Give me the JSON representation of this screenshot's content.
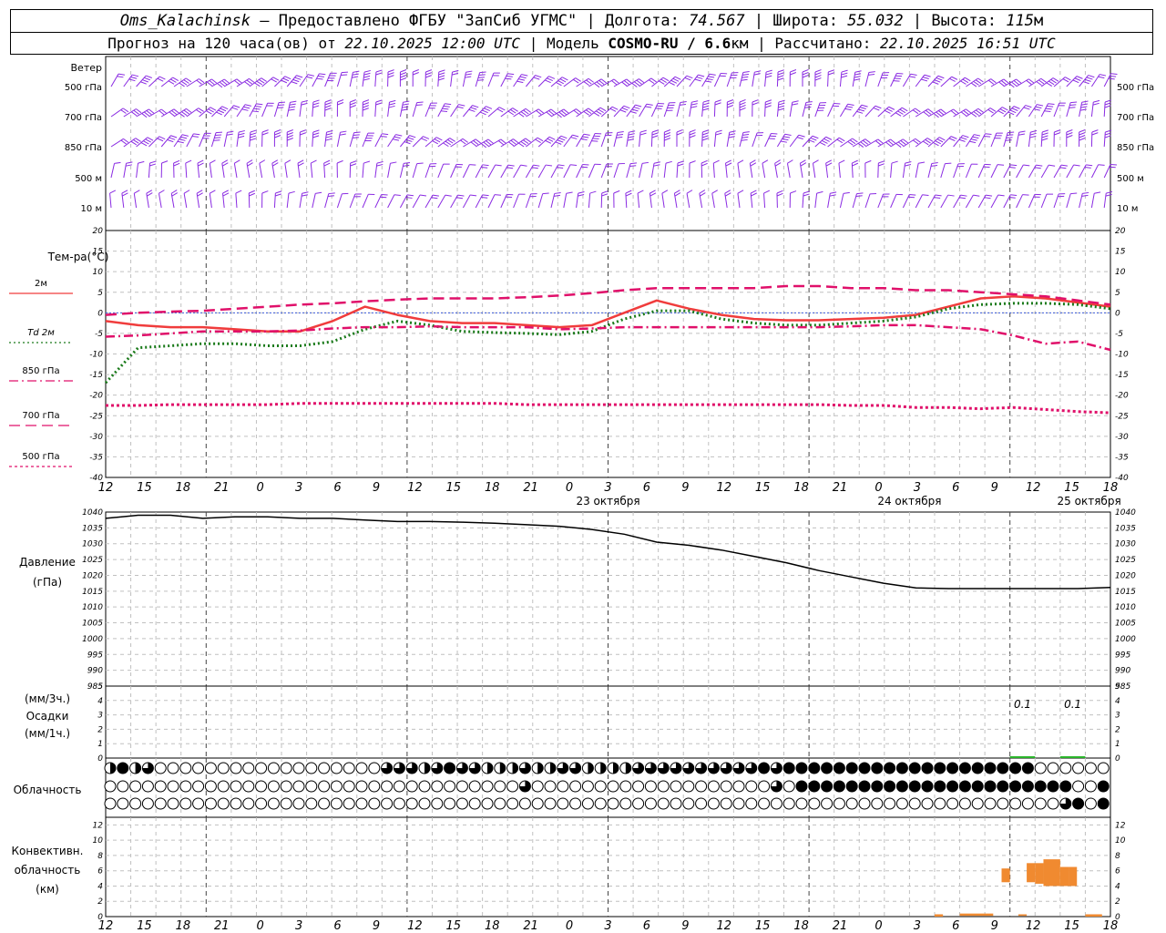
{
  "header": {
    "station": "Oms_Kalachinsk",
    "provider": "Предоставлено ФГБУ \"ЗапСиб УГМС\"",
    "lon_label": "Долгота:",
    "lon_value": "74.567",
    "lat_label": "Широта:",
    "lat_value": "55.032",
    "alt_label": "Высота:",
    "alt_value": "115",
    "alt_unit": "м",
    "forecast_label": "Прогноз на 120 часа(ов) от",
    "forecast_time": "22.10.2025 12:00 UTC",
    "model_label": "Модель",
    "model_name": "COSMO-RU / 6.6",
    "model_unit": "км",
    "calc_label": "Рассчитано:",
    "calc_time": "22.10.2025 16:51 UTC"
  },
  "chart_data": [
    {
      "type": "wind_barbs",
      "panel_label": "Ветер",
      "levels": [
        "500 гПа",
        "700 гПа",
        "850 гПа",
        "500 м",
        "10 м"
      ],
      "barb_color": "#8a2be2"
    },
    {
      "type": "line",
      "ylabel": "Тем-ра(°C)",
      "ylim": [
        -40,
        20
      ],
      "yticks": [
        20,
        15,
        10,
        5,
        0,
        -5,
        -10,
        -15,
        -20,
        -25,
        -30,
        -35,
        -40
      ],
      "x_hours": [
        0,
        3,
        6,
        9,
        12,
        15,
        18,
        21,
        24,
        27,
        30,
        33,
        36,
        39,
        42,
        45,
        48,
        51,
        54,
        57,
        60,
        63,
        66,
        69,
        72,
        75,
        78,
        81,
        84,
        87,
        90,
        93,
        96,
        99,
        102,
        105,
        108,
        111,
        114,
        117,
        120
      ],
      "legend": [
        {
          "name": "2м",
          "prefix": "",
          "color": "#f03c3c",
          "dash": "solid"
        },
        {
          "name": "2м",
          "prefix": "Td",
          "color": "#1a7a1a",
          "dash": "dotted"
        },
        {
          "name": "850 гПа",
          "prefix": "",
          "color": "#e0106a",
          "dash": "dashdot"
        },
        {
          "name": "700 гПа",
          "prefix": "",
          "color": "#e0106a",
          "dash": "dash"
        },
        {
          "name": "500 гПа",
          "prefix": "",
          "color": "#e0106a",
          "dash": "dot"
        }
      ],
      "series": [
        {
          "key": "t2m",
          "values": [
            -2,
            -3,
            -3.5,
            -3.5,
            -4,
            -4.5,
            -4.5,
            -2,
            1.5,
            -0.5,
            -2,
            -2.5,
            -2.5,
            -3,
            -3.5,
            -3,
            0,
            3,
            1,
            -0.5,
            -1.5,
            -1.8,
            -1.8,
            -1.5,
            -1.2,
            -0.5,
            1.5,
            3.5,
            4,
            3.5,
            2.5,
            1.5
          ]
        },
        {
          "key": "td2m",
          "values": [
            -17,
            -8.5,
            -8,
            -7.5,
            -7.5,
            -8,
            -8,
            -7,
            -4,
            -2,
            -3,
            -4.5,
            -4.8,
            -5,
            -5.3,
            -4.5,
            -1.5,
            0.5,
            0.5,
            -1.5,
            -2.5,
            -3,
            -3,
            -2.5,
            -2,
            -1,
            1,
            2,
            2.3,
            2.3,
            2,
            1
          ]
        },
        {
          "key": "t850",
          "values": [
            -5.8,
            -5.5,
            -5,
            -4.5,
            -4.5,
            -4.5,
            -4.3,
            -3.8,
            -3.5,
            -3.5,
            -3.3,
            -3.5,
            -3.5,
            -3.5,
            -4,
            -3.8,
            -3.5,
            -3.5,
            -3.5,
            -3.5,
            -3.5,
            -3.5,
            -3.5,
            -3.3,
            -3,
            -3,
            -3.5,
            -4,
            -5.5,
            -7.5,
            -7,
            -9
          ]
        },
        {
          "key": "t700",
          "values": [
            -0.5,
            0,
            0.3,
            0.5,
            1,
            1.5,
            2,
            2.3,
            2.8,
            3.2,
            3.5,
            3.5,
            3.5,
            3.8,
            4.2,
            4.8,
            5.5,
            6,
            6,
            6,
            6,
            6.5,
            6.5,
            6,
            6,
            5.5,
            5.5,
            5,
            4.5,
            4,
            3,
            2
          ]
        },
        {
          "key": "t500",
          "values": [
            -22.5,
            -22.5,
            -22.3,
            -22.3,
            -22.3,
            -22.3,
            -22,
            -22,
            -22,
            -22,
            -22,
            -22,
            -22,
            -22.3,
            -22.3,
            -22.3,
            -22.3,
            -22.3,
            -22.3,
            -22.3,
            -22.3,
            -22.3,
            -22.3,
            -22.5,
            -22.5,
            -23,
            -23,
            -23.3,
            -23,
            -23.5,
            -24,
            -24.3
          ]
        }
      ]
    },
    {
      "type": "line",
      "ylabel": "Давление",
      "yunit": "(гПа)",
      "ylim": [
        985,
        1040
      ],
      "yticks": [
        1040,
        1035,
        1030,
        1025,
        1020,
        1015,
        1010,
        1005,
        1000,
        995,
        990,
        985
      ],
      "values": [
        1038,
        1039,
        1039,
        1038,
        1038.5,
        1038.5,
        1038,
        1038,
        1037.5,
        1037,
        1037,
        1036.8,
        1036.5,
        1036,
        1035.5,
        1034.5,
        1033,
        1030.5,
        1029.5,
        1028,
        1026,
        1024,
        1021.5,
        1019.5,
        1017.5,
        1016,
        1015.8,
        1015.8,
        1015.8,
        1015.8,
        1015.8,
        1016.2
      ]
    },
    {
      "type": "bar",
      "ylabel_top": "(мм/3ч.)",
      "ylabel_mid": "Осадки",
      "ylabel_bot": "(мм/1ч.)",
      "ylim": [
        0,
        5
      ],
      "yticks": [
        5,
        4,
        3,
        2,
        1,
        0
      ],
      "bars": [
        {
          "start_hour": 108,
          "end_hour": 111,
          "value": 0.1,
          "label": "0.1"
        },
        {
          "start_hour": 114,
          "end_hour": 117,
          "value": 0.1,
          "label": "0.1"
        }
      ],
      "color": "#2ab52a"
    },
    {
      "type": "cloud_cover",
      "label": "Облачность",
      "rows": [
        [
          2,
          4,
          2,
          2,
          3,
          2,
          0,
          0,
          0,
          0,
          0,
          0,
          0,
          0,
          0,
          0,
          0,
          0,
          0,
          0,
          0,
          0,
          0,
          0,
          0,
          0,
          0,
          0,
          0,
          0,
          0,
          0,
          0,
          3,
          3,
          3,
          3,
          2,
          3,
          3,
          4,
          3,
          3,
          3,
          2,
          2,
          2,
          2,
          2,
          3,
          2,
          2,
          2,
          3,
          3,
          3,
          3,
          2,
          2,
          2,
          2,
          2,
          2,
          3,
          3,
          3,
          3,
          3,
          3,
          3,
          3,
          3,
          3,
          3,
          2,
          3,
          3,
          3,
          4,
          3,
          4,
          4,
          4,
          4,
          4,
          4,
          4,
          4,
          4,
          4,
          4,
          4,
          4,
          4,
          4,
          4,
          4,
          4,
          4,
          4,
          4,
          4,
          4,
          4,
          4,
          4,
          4,
          4,
          4,
          4,
          3,
          0,
          0,
          0,
          0,
          0,
          0,
          0,
          0,
          0
        ],
        [
          0,
          0,
          0,
          0,
          0,
          0,
          0,
          0,
          0,
          0,
          0,
          0,
          0,
          0,
          0,
          0,
          0,
          0,
          0,
          0,
          0,
          0,
          0,
          0,
          0,
          0,
          0,
          0,
          0,
          0,
          0,
          0,
          0,
          0,
          0,
          0,
          0,
          0,
          0,
          0,
          0,
          0,
          0,
          0,
          0,
          0,
          0,
          0,
          0,
          0,
          0,
          0,
          0,
          3,
          4,
          0,
          0,
          0,
          0,
          0,
          0,
          0,
          0,
          0,
          0,
          0,
          0,
          0,
          0,
          0,
          0,
          0,
          0,
          0,
          0,
          0,
          0,
          2,
          0,
          0,
          0,
          0,
          0,
          0,
          0,
          0,
          3,
          0,
          4,
          4,
          4,
          4,
          4,
          4,
          4,
          4,
          4,
          4,
          4,
          4,
          4,
          4,
          4,
          4,
          4,
          4,
          4,
          4,
          4,
          4,
          4,
          4,
          4,
          4,
          4,
          4,
          4,
          4,
          4,
          4,
          4,
          4,
          4,
          4,
          4,
          0,
          0,
          3,
          4,
          4
        ],
        [
          0,
          0,
          0,
          0,
          0,
          0,
          0,
          0,
          0,
          0,
          0,
          0,
          0,
          0,
          0,
          0,
          0,
          0,
          0,
          0,
          0,
          0,
          0,
          0,
          0,
          0,
          0,
          0,
          0,
          0,
          0,
          0,
          0,
          0,
          0,
          0,
          0,
          0,
          0,
          0,
          0,
          0,
          0,
          0,
          0,
          0,
          0,
          0,
          0,
          0,
          0,
          0,
          0,
          0,
          0,
          0,
          0,
          0,
          0,
          0,
          0,
          0,
          0,
          0,
          0,
          0,
          0,
          0,
          0,
          0,
          0,
          0,
          0,
          0,
          0,
          0,
          0,
          0,
          0,
          0,
          0,
          0,
          0,
          0,
          0,
          0,
          0,
          0,
          0,
          0,
          0,
          0,
          0,
          0,
          0,
          0,
          0,
          0,
          0,
          0,
          0,
          0,
          0,
          0,
          0,
          0,
          0,
          0,
          0,
          0,
          0,
          0,
          0,
          0,
          0,
          0,
          0,
          0,
          0,
          0,
          0,
          0,
          0,
          0,
          0,
          3,
          4,
          4,
          0,
          3,
          4,
          4
        ]
      ]
    },
    {
      "type": "bar",
      "ylabel_top": "Конвективн.",
      "ylabel_mid": "облачность",
      "ylabel_bot": "(км)",
      "ylim": [
        0,
        13
      ],
      "yticks": [
        12,
        10,
        8,
        6,
        4,
        2,
        0
      ],
      "color": "#f08a30",
      "cells": [
        {
          "start_hour": 99,
          "end_hour": 100,
          "base": 0,
          "top": 0.3
        },
        {
          "start_hour": 102,
          "end_hour": 106,
          "base": 0.1,
          "top": 0.4
        },
        {
          "start_hour": 107,
          "end_hour": 108,
          "base": 4.5,
          "top": 6.3
        },
        {
          "start_hour": 109,
          "end_hour": 110,
          "base": 0.1,
          "top": 0.3
        },
        {
          "start_hour": 110,
          "end_hour": 111,
          "base": 4.5,
          "top": 7
        },
        {
          "start_hour": 111,
          "end_hour": 112,
          "base": 4.3,
          "top": 7
        },
        {
          "start_hour": 112,
          "end_hour": 114,
          "base": 4,
          "top": 7.5
        },
        {
          "start_hour": 114,
          "end_hour": 115,
          "base": 4,
          "top": 6.5
        },
        {
          "start_hour": 115,
          "end_hour": 116,
          "base": 4,
          "top": 6.5
        },
        {
          "start_hour": 117,
          "end_hour": 119,
          "base": 0,
          "top": 0.3
        }
      ]
    }
  ],
  "x_axis": {
    "ticks": [
      "12",
      "15",
      "18",
      "21",
      "0",
      "3",
      "6",
      "9",
      "12",
      "15",
      "18",
      "21",
      "0",
      "3",
      "6",
      "9",
      "12",
      "15",
      "18",
      "21",
      "0",
      "3",
      "6",
      "9",
      "12",
      "15",
      "18"
    ],
    "days": [
      "23 октября",
      "24 октября",
      "25 октября"
    ]
  },
  "colors": {
    "wind": "#8a2be2",
    "t2m": "#f03c3c",
    "td": "#1a7a1a",
    "upper": "#e0106a",
    "precip": "#2ab52a",
    "conv": "#f08a30",
    "zero_line": "#3b5bdb"
  }
}
